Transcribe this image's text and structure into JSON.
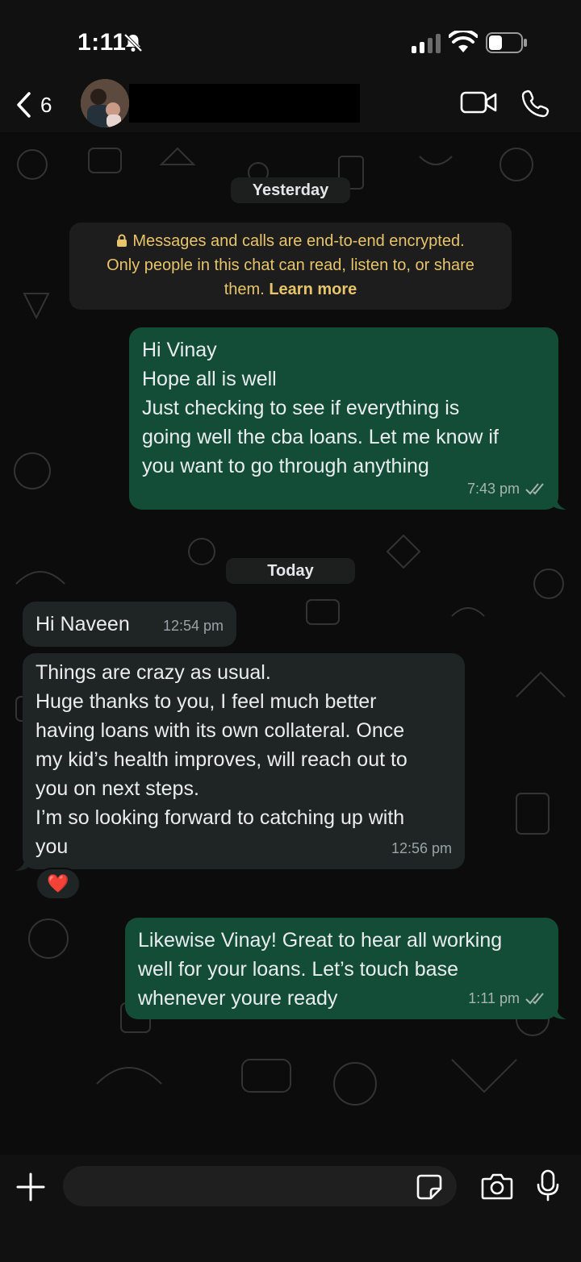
{
  "status_bar": {
    "time": "1:11"
  },
  "header": {
    "back_count": "6"
  },
  "chat": {
    "date_yesterday": "Yesterday",
    "encryption": {
      "line1": "Messages and calls are end-to-end encrypted.",
      "line2": "Only people in this chat can read, listen to, or share",
      "line3": "them.",
      "learn_more": "Learn more"
    },
    "messages": [
      {
        "direction": "out",
        "text": "Hi Vinay\nHope all is well\nJust checking to see if everything is\ngoing well the cba loans. Let me know if\nyou want to go through anything",
        "time": "7:43 pm",
        "status": "read"
      },
      {
        "direction": "in",
        "text": "Hi Naveen",
        "time": "12:54 pm"
      },
      {
        "direction": "in",
        "text": "Things are crazy as usual.\nHuge thanks to you, I feel much better\nhaving loans with its own collateral. Once\nmy kid’s health improves, will reach out to\nyou on next steps.\nI’m so looking forward to catching up with\nyou",
        "time": "12:56 pm",
        "reaction": "❤️"
      },
      {
        "direction": "out",
        "text": "Likewise Vinay! Great to hear all working\nwell for your loans. Let’s touch base\nwhenever youre ready",
        "time": "1:11 pm",
        "status": "read"
      }
    ],
    "date_today": "Today"
  },
  "composer": {
    "placeholder": ""
  },
  "colors": {
    "outgoing_bubble": "#134d37",
    "incoming_bubble": "#1f2424",
    "encryption_text": "#e8c46a",
    "background": "#0c0c0c"
  },
  "icons": [
    "bell-off-icon",
    "signal-icon",
    "wifi-icon",
    "battery-icon",
    "chevron-left-icon",
    "video-icon",
    "phone-icon",
    "plus-icon",
    "sticker-icon",
    "camera-icon",
    "mic-icon",
    "lock-icon",
    "double-check-icon"
  ]
}
